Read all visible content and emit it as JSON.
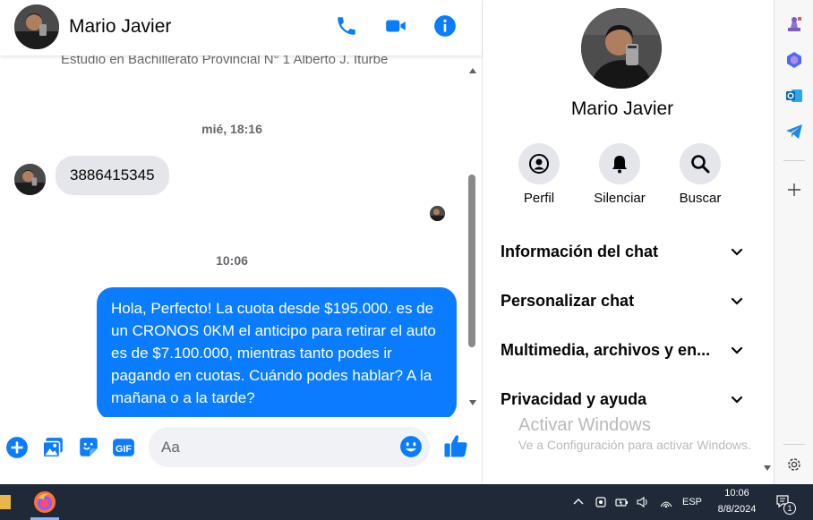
{
  "header": {
    "contact_name": "Mario Javier",
    "icons": [
      "phone-icon",
      "video-camera-icon",
      "info-icon"
    ],
    "accent": "#0a7cff"
  },
  "conversation": {
    "cut_off_text": "Estudió en Bachillerato Provincial N° 1 Alberto J. Iturbe",
    "timestamp_1": "mié, 18:16",
    "incoming_message": "3886415345",
    "timestamp_2": "10:06",
    "outgoing_message": "Hola, Perfecto! La cuota desde $195.000. es de un CRONOS 0KM el anticipo para retirar el auto es de $7.100.000, mientras tanto podes ir pagando en cuotas. Cuándo podes hablar? A la mañana o a la tarde?",
    "outgoing_color": "#0a7cff",
    "incoming_color": "#e4e6eb"
  },
  "composer": {
    "placeholder": "Aa",
    "icons": [
      "plus-circle-icon",
      "image-icon",
      "sticker-icon",
      "gif-icon",
      "emoji-icon",
      "thumbs-up-icon"
    ],
    "gif_label": "GIF"
  },
  "panel": {
    "name": "Mario Javier",
    "actions": [
      {
        "label": "Perfil",
        "icon": "profile-icon"
      },
      {
        "label": "Silenciar",
        "icon": "bell-icon"
      },
      {
        "label": "Buscar",
        "icon": "search-icon"
      }
    ],
    "sections": [
      "Información del chat",
      "Personalizar chat",
      "Multimedia, archivos y en...",
      "Privacidad y ayuda"
    ]
  },
  "watermark": {
    "title": "Activar Windows",
    "subtitle": "Ve a Configuración para activar Windows."
  },
  "edge_sidebar": {
    "icons": [
      "chess-icon",
      "copilot-icon",
      "outlook-icon",
      "telegram-icon",
      "add-icon",
      "settings-icon"
    ]
  },
  "taskbar": {
    "language": "ESP",
    "time": "10:06",
    "date": "8/8/2024",
    "notification_count": "1",
    "apps": [
      "file-explorer-icon",
      "firefox-icon"
    ]
  }
}
